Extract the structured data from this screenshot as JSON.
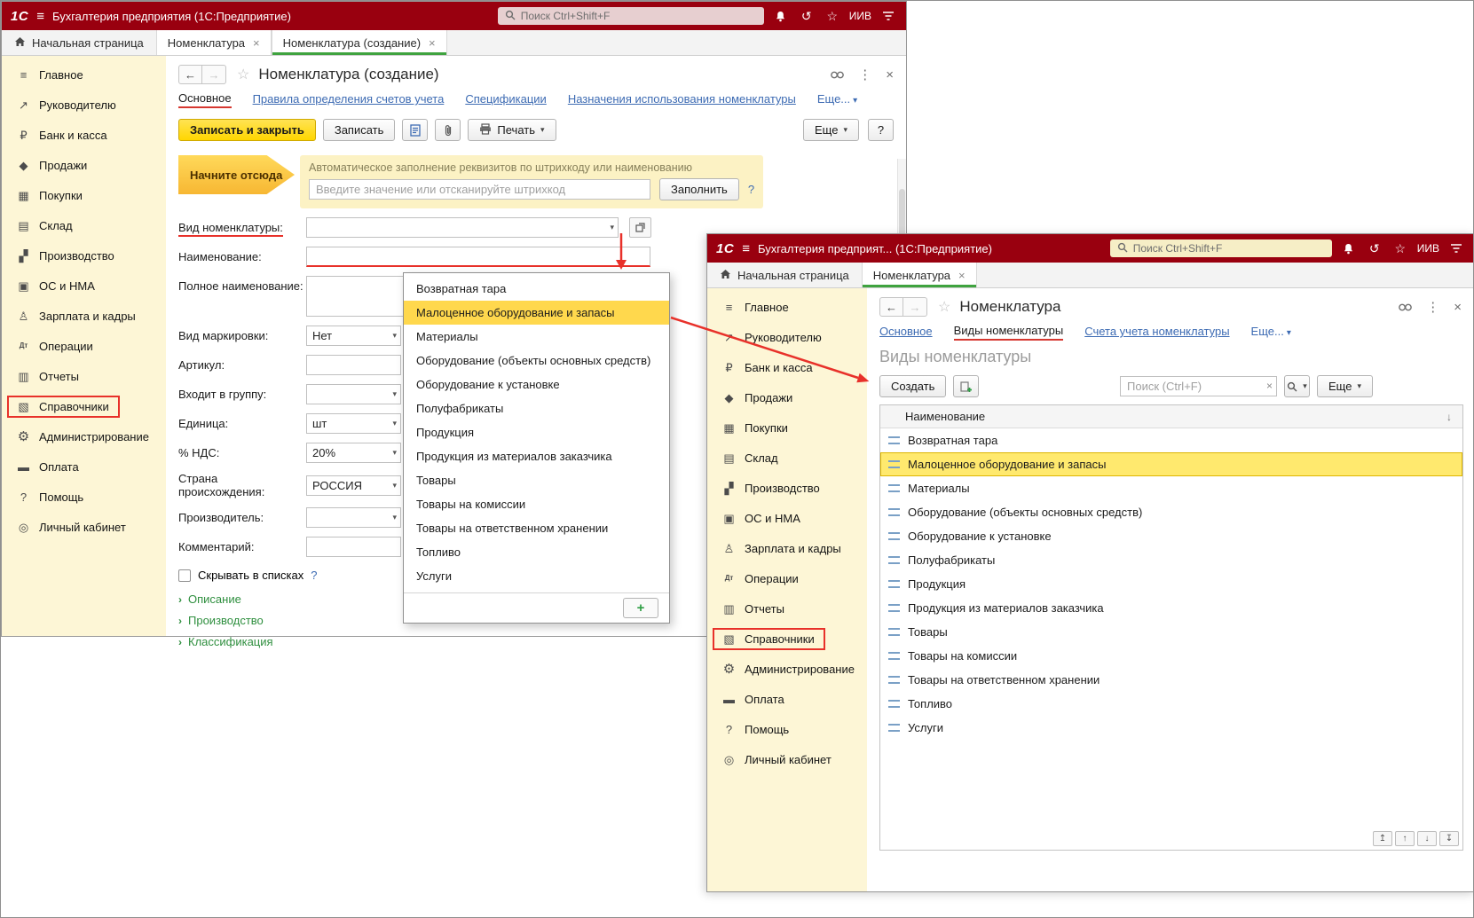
{
  "logo": "1С",
  "colors": {
    "titlebar": "#99000f",
    "sidebar": "#fdf6d6",
    "primary_button": "#ffd600",
    "dropdown_selection": "#ffd84d",
    "row_selection": "#ffe96e",
    "link": "#3d6bb3",
    "annotation_red": "#e8312a",
    "active_tab_underline": "#3fa33f",
    "required_underline": "#e8312a"
  },
  "icons": {
    "hamburger": "≡",
    "star": "☆",
    "history": "↺",
    "menu_dots": "⋮",
    "close": "×",
    "caret": "▾",
    "back": "←",
    "forward": "→",
    "plus": "+",
    "sort_desc": "↓",
    "chevron_right": "›",
    "pager_top": "↥",
    "pager_up": "↑",
    "pager_down": "↓",
    "pager_bottom": "↧"
  },
  "icon_glyphs": {
    "main-menu": "≡",
    "trend-chart": "↗",
    "bank-ruble": "₽",
    "sales": "◆",
    "purchases-cart": "▦",
    "warehouse": "▤",
    "production": "▞",
    "fixed-assets": "▣",
    "staff": "♙",
    "dt-kt": "Дт",
    "reports": "▥",
    "catalogs": "▧",
    "admin-gear": "⚙",
    "payment": "▬",
    "help": "?",
    "account": "◎"
  },
  "annotation": {
    "hint": "Начните отсюда"
  },
  "sidebar_items": [
    {
      "label": "Главное",
      "icon": "main-menu"
    },
    {
      "label": "Руководителю",
      "icon": "trend-chart"
    },
    {
      "label": "Банк и касса",
      "icon": "bank-ruble"
    },
    {
      "label": "Продажи",
      "icon": "sales"
    },
    {
      "label": "Покупки",
      "icon": "purchases-cart"
    },
    {
      "label": "Склад",
      "icon": "warehouse"
    },
    {
      "label": "Производство",
      "icon": "production"
    },
    {
      "label": "ОС и НМА",
      "icon": "fixed-assets"
    },
    {
      "label": "Зарплата и кадры",
      "icon": "staff"
    },
    {
      "label": "Операции",
      "icon": "dt-kt"
    },
    {
      "label": "Отчеты",
      "icon": "reports"
    },
    {
      "label": "Справочники",
      "icon": "catalogs",
      "highlighted": true
    },
    {
      "label": "Администрирование",
      "icon": "admin-gear"
    },
    {
      "label": "Оплата",
      "icon": "payment"
    },
    {
      "label": "Помощь",
      "icon": "help"
    },
    {
      "label": "Личный кабинет",
      "icon": "account"
    }
  ],
  "nomenclature_types": [
    {
      "label": "Возвратная тара"
    },
    {
      "label": "Малоценное оборудование и запасы",
      "selected": true
    },
    {
      "label": "Материалы"
    },
    {
      "label": "Оборудование (объекты основных средств)"
    },
    {
      "label": "Оборудование к установке"
    },
    {
      "label": "Полуфабрикаты"
    },
    {
      "label": "Продукция"
    },
    {
      "label": "Продукция из материалов заказчика"
    },
    {
      "label": "Товары"
    },
    {
      "label": "Товары на комиссии"
    },
    {
      "label": "Товары на ответственном хранении"
    },
    {
      "label": "Топливо"
    },
    {
      "label": "Услуги"
    }
  ],
  "window1": {
    "header": {
      "title": "Бухгалтерия предприятия  (1С:Предприятие)",
      "search_placeholder": "Поиск Ctrl+Shift+F",
      "user": "ИИВ"
    },
    "tabbar": {
      "home": "Начальная страница",
      "tabs": [
        {
          "label": "Номенклатура"
        },
        {
          "label": "Номенклатура (создание)",
          "active": true
        }
      ]
    },
    "page": {
      "title": "Номенклатура (создание)",
      "nav_links": [
        {
          "label": "Основное",
          "active": true
        },
        {
          "label": "Правила определения счетов учета"
        },
        {
          "label": "Спецификации"
        },
        {
          "label": "Назначения использования номенклатуры"
        },
        {
          "label": "Еще...",
          "caret": true
        }
      ],
      "toolbar": {
        "save_close": "Записать и закрыть",
        "save": "Записать",
        "print": "Печать",
        "more": "Еще",
        "help": "?"
      },
      "autofill": {
        "caption": "Автоматическое заполнение реквизитов по штрихкоду или наименованию",
        "input_placeholder": "Введите значение или отсканируйте штрихкод",
        "fill_button": "Заполнить",
        "help": "?"
      },
      "fields": {
        "type_label": "Вид номенклатуры:",
        "name_label": "Наименование:",
        "full_name_label": "Полное наименование:",
        "marking_label": "Вид маркировки:",
        "marking_value": "Нет",
        "article_label": "Артикул:",
        "group_label": "Входит в группу:",
        "unit_label": "Единица:",
        "unit_value": "шт",
        "vat_label": "% НДС:",
        "vat_value": "20%",
        "country_label": "Страна происхождения:",
        "country_value": "РОССИЯ",
        "producer_label": "Производитель:",
        "comment_label": "Комментарий:"
      },
      "hide_checkbox": "Скрывать в списках",
      "hide_help": "?",
      "groups": [
        {
          "label": "Описание"
        },
        {
          "label": "Производство"
        },
        {
          "label": "Классификация"
        }
      ]
    }
  },
  "window2": {
    "header": {
      "title": "Бухгалтерия предприят...  (1С:Предприятие)",
      "search_placeholder": "Поиск Ctrl+Shift+F",
      "user": "ИИВ"
    },
    "tabbar": {
      "home": "Начальная страница",
      "tabs": [
        {
          "label": "Номенклатура",
          "active": true
        }
      ]
    },
    "page": {
      "title": "Номенклатура",
      "nav_links": [
        {
          "label": "Основное"
        },
        {
          "label": "Виды номенклатуры",
          "active": true
        },
        {
          "label": "Счета учета номенклатуры"
        },
        {
          "label": "Еще...",
          "caret": true
        }
      ],
      "heading": "Виды номенклатуры",
      "toolbar": {
        "create": "Создать",
        "search_placeholder": "Поиск (Ctrl+F)",
        "more": "Еще"
      },
      "table": {
        "name_column": "Наименование"
      }
    }
  }
}
